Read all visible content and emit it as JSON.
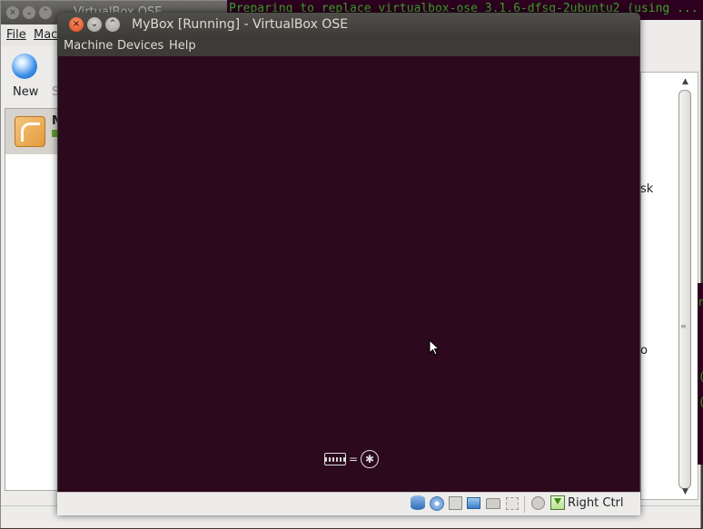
{
  "terminal": {
    "text": "Preparing to replace virtualbox-ose 3.1.6-dfsg-2ubuntu2 (using ...",
    "glyphs": [
      "n",
      "(",
      "("
    ]
  },
  "manager_window": {
    "title": "VirtualBox OSE",
    "menu": [
      "File",
      "Mach"
    ],
    "toolbar": {
      "new_label": "New",
      "second_label": "S"
    },
    "vm_list": {
      "first_item_initial": "M"
    },
    "details": {
      "text1": "sk",
      "text2": "o"
    }
  },
  "vm_window": {
    "title": "MyBox [Running] - VirtualBox OSE",
    "menu": [
      "Machine",
      "Devices",
      "Help"
    ],
    "screen": {
      "accessibility_eq": "="
    },
    "statusbar": {
      "icons": [
        "hard-disk-icon",
        "cd-dvd-icon",
        "floppy-icon",
        "network-icon",
        "shared-folders-icon",
        "usb-icon",
        "mouse-integration-icon",
        "host-key-icon"
      ],
      "host_key_label": "Right Ctrl"
    },
    "colors": {
      "screen_bg": "#2c091c",
      "titlebar": "#3c3b37"
    }
  }
}
